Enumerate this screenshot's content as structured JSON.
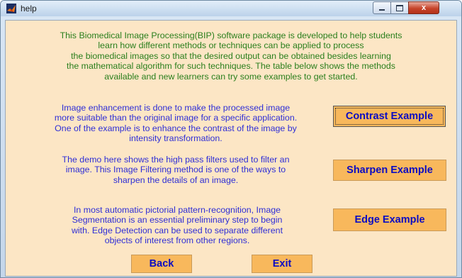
{
  "window": {
    "title": "help"
  },
  "titlebar": {
    "minimize": "minimize",
    "maximize": "maximize",
    "close_glyph": "x"
  },
  "intro": "This Biomedical Image Processing(BIP) software package is developed to help students\nlearn how different methods or techniques can be applied to process\nthe biomedical images so that the desired output can be obtained besides learning\nthe mathematical algorithm for such techniques. The table below shows the methods\navailable and new learners can try some examples to get started.",
  "sections": [
    {
      "description": "Image enhancement is done to make the processed image\nmore suitable than the original image for a specific application.\nOne of the example is to enhance the contrast of the image by\nintensity transformation.",
      "button": "Contrast Example"
    },
    {
      "description": "The demo here shows the high pass filters used to filter an\nimage. This Image Filtering method is one of the ways to\nsharpen the details of an image.",
      "button": "Sharpen Example"
    },
    {
      "description": "In most automatic pictorial pattern-recognition, Image\nSegmentation is an essential preliminary step to begin\nwith. Edge Detection can be used to separate different\nobjects of interest from other regions.",
      "button": "Edge Example"
    }
  ],
  "footer": {
    "back": "Back",
    "exit": "Exit"
  },
  "colors": {
    "panel_bg": "#fce6c5",
    "intro_text": "#2a7f1d",
    "description_text": "#2f2fd6",
    "button_bg": "#f8b85c",
    "button_text": "#0c0cc2"
  },
  "icons": {
    "app": "matlab-figure-icon",
    "minimize": "minimize-icon",
    "maximize": "maximize-icon",
    "close": "close-icon"
  }
}
